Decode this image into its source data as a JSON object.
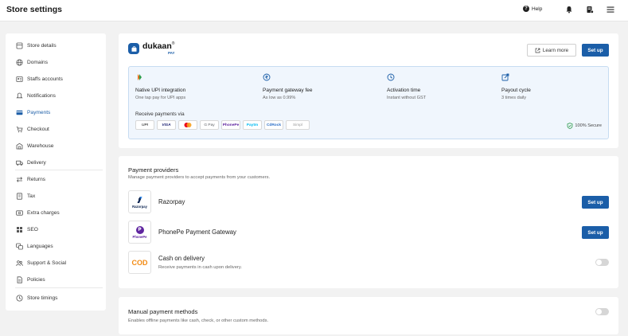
{
  "header": {
    "title": "Store settings",
    "help_label": "Help"
  },
  "sidebar": {
    "items": [
      {
        "label": "Store details",
        "icon": "store-icon"
      },
      {
        "label": "Domains",
        "icon": "globe-icon"
      },
      {
        "label": "Staffs accounts",
        "icon": "staff-icon"
      },
      {
        "label": "Notifications",
        "icon": "bell-icon"
      },
      {
        "label": "Payments",
        "icon": "card-icon"
      },
      {
        "label": "Checkout",
        "icon": "cart-icon"
      },
      {
        "label": "Warehouse",
        "icon": "warehouse-icon"
      },
      {
        "label": "Delivery",
        "icon": "truck-icon"
      },
      {
        "label": "Returns",
        "icon": "returns-icon"
      },
      {
        "label": "Tax",
        "icon": "tax-icon"
      },
      {
        "label": "Extra charges",
        "icon": "charges-icon"
      },
      {
        "label": "SEO",
        "icon": "seo-icon"
      },
      {
        "label": "Languages",
        "icon": "language-icon"
      },
      {
        "label": "Support & Social",
        "icon": "support-icon"
      },
      {
        "label": "Policies",
        "icon": "policy-icon"
      },
      {
        "label": "Store timings",
        "icon": "clock-icon"
      }
    ],
    "active": "Payments"
  },
  "dukaan_pay": {
    "brand": "dukaan",
    "brand_mark": "®",
    "brand_sub": "PAY",
    "learn_more_label": "Learn more",
    "setup_label": "Set up",
    "features": [
      {
        "title": "Native UPI integration",
        "subtitle": "One tap pay for UPI apps"
      },
      {
        "title": "Payment gateway fee",
        "subtitle": "As low as 0.99%"
      },
      {
        "title": "Activation time",
        "subtitle": "Instant without GST"
      },
      {
        "title": "Payout cycle",
        "subtitle": "3 times daily"
      }
    ],
    "receive_label": "Receive payments via",
    "methods": [
      "UPI",
      "VISA",
      "",
      "G Pay",
      "PhonePe",
      "Paytm",
      "CdRock",
      "Simpl"
    ],
    "secure_label": "100% Secure"
  },
  "providers": {
    "title": "Payment providers",
    "subtitle": "Manage payment providers to accept payments from your customers.",
    "items": [
      {
        "name": "Razorpay",
        "logo_text": "Razorpay",
        "action": "Set up"
      },
      {
        "name": "PhonePe Payment Gateway",
        "logo_text": "PhonePe",
        "action": "Set up"
      },
      {
        "name": "Cash on delivery",
        "logo_text": "COD",
        "description": "Receive payments in cash upon delivery."
      }
    ]
  },
  "manual": {
    "title": "Manual payment methods",
    "subtitle": "Enables offline payments like cash, check, or other custom methods."
  },
  "colors": {
    "primary": "#1b5ea8",
    "active_nav": "#1e5fa8",
    "info_bg": "#f0f6fd",
    "cod": "#f28a12",
    "phonepe": "#5f259f",
    "secure": "#2e9b4e"
  }
}
